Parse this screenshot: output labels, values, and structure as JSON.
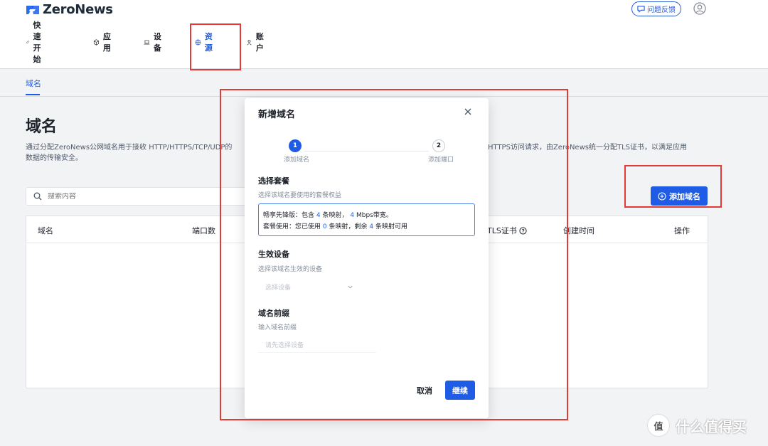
{
  "app": {
    "name": "ZeroNews",
    "brand_color": "#1e5ce6"
  },
  "header": {
    "feedback_label": "问题反馈"
  },
  "nav": {
    "items": [
      {
        "label": "快速开始",
        "icon": "rocket-icon"
      },
      {
        "label": "应用",
        "icon": "cube-icon"
      },
      {
        "label": "设备",
        "icon": "laptop-icon"
      },
      {
        "label": "资源",
        "icon": "globe-icon",
        "active": true
      },
      {
        "label": "账户",
        "icon": "user-icon"
      }
    ]
  },
  "subtab": {
    "label": "域名"
  },
  "page": {
    "title": "域名",
    "desc_line1": "通过分配ZeroNews公网域名用于接收 HTTP/HTTPS/TCP/UDP的",
    "desc_line1_right": "HTTPS访问请求，由ZeroNews统一分配TLS证书，以满足应用",
    "desc_line2": "数据的传输安全。",
    "search_placeholder": "搜索内容",
    "add_button": "添加域名"
  },
  "table": {
    "headers": {
      "domain": "域名",
      "ports": "端口数",
      "tls": "TLS证书",
      "created": "创建时间",
      "actions": "操作"
    }
  },
  "modal": {
    "title": "新增域名",
    "steps": [
      {
        "num": "1",
        "label": "添加域名"
      },
      {
        "num": "2",
        "label": "添加端口"
      }
    ],
    "plan": {
      "title": "选择套餐",
      "sub": "选择该域名要使用的套餐权益",
      "line1_a": "畅享先锋版：包含",
      "line1_n1": "4",
      "line1_b": "条映射，",
      "line1_n2": "4",
      "line1_c": "Mbps带宽。",
      "line2_a": "套餐使用：您已使用",
      "line2_n1": "0",
      "line2_b": "条映射，剩余",
      "line2_n2": "4",
      "line2_c": "条映射可用"
    },
    "device": {
      "title": "生效设备",
      "sub": "选择该域名生效的设备",
      "placeholder": "选择设备"
    },
    "prefix": {
      "title": "域名前缀",
      "sub": "输入域名前缀",
      "placeholder": "请先选择设备"
    },
    "cancel": "取消",
    "continue": "继续"
  },
  "watermark": {
    "mark": "值",
    "text": "什么值得买"
  },
  "highlight_color": "#e53935"
}
